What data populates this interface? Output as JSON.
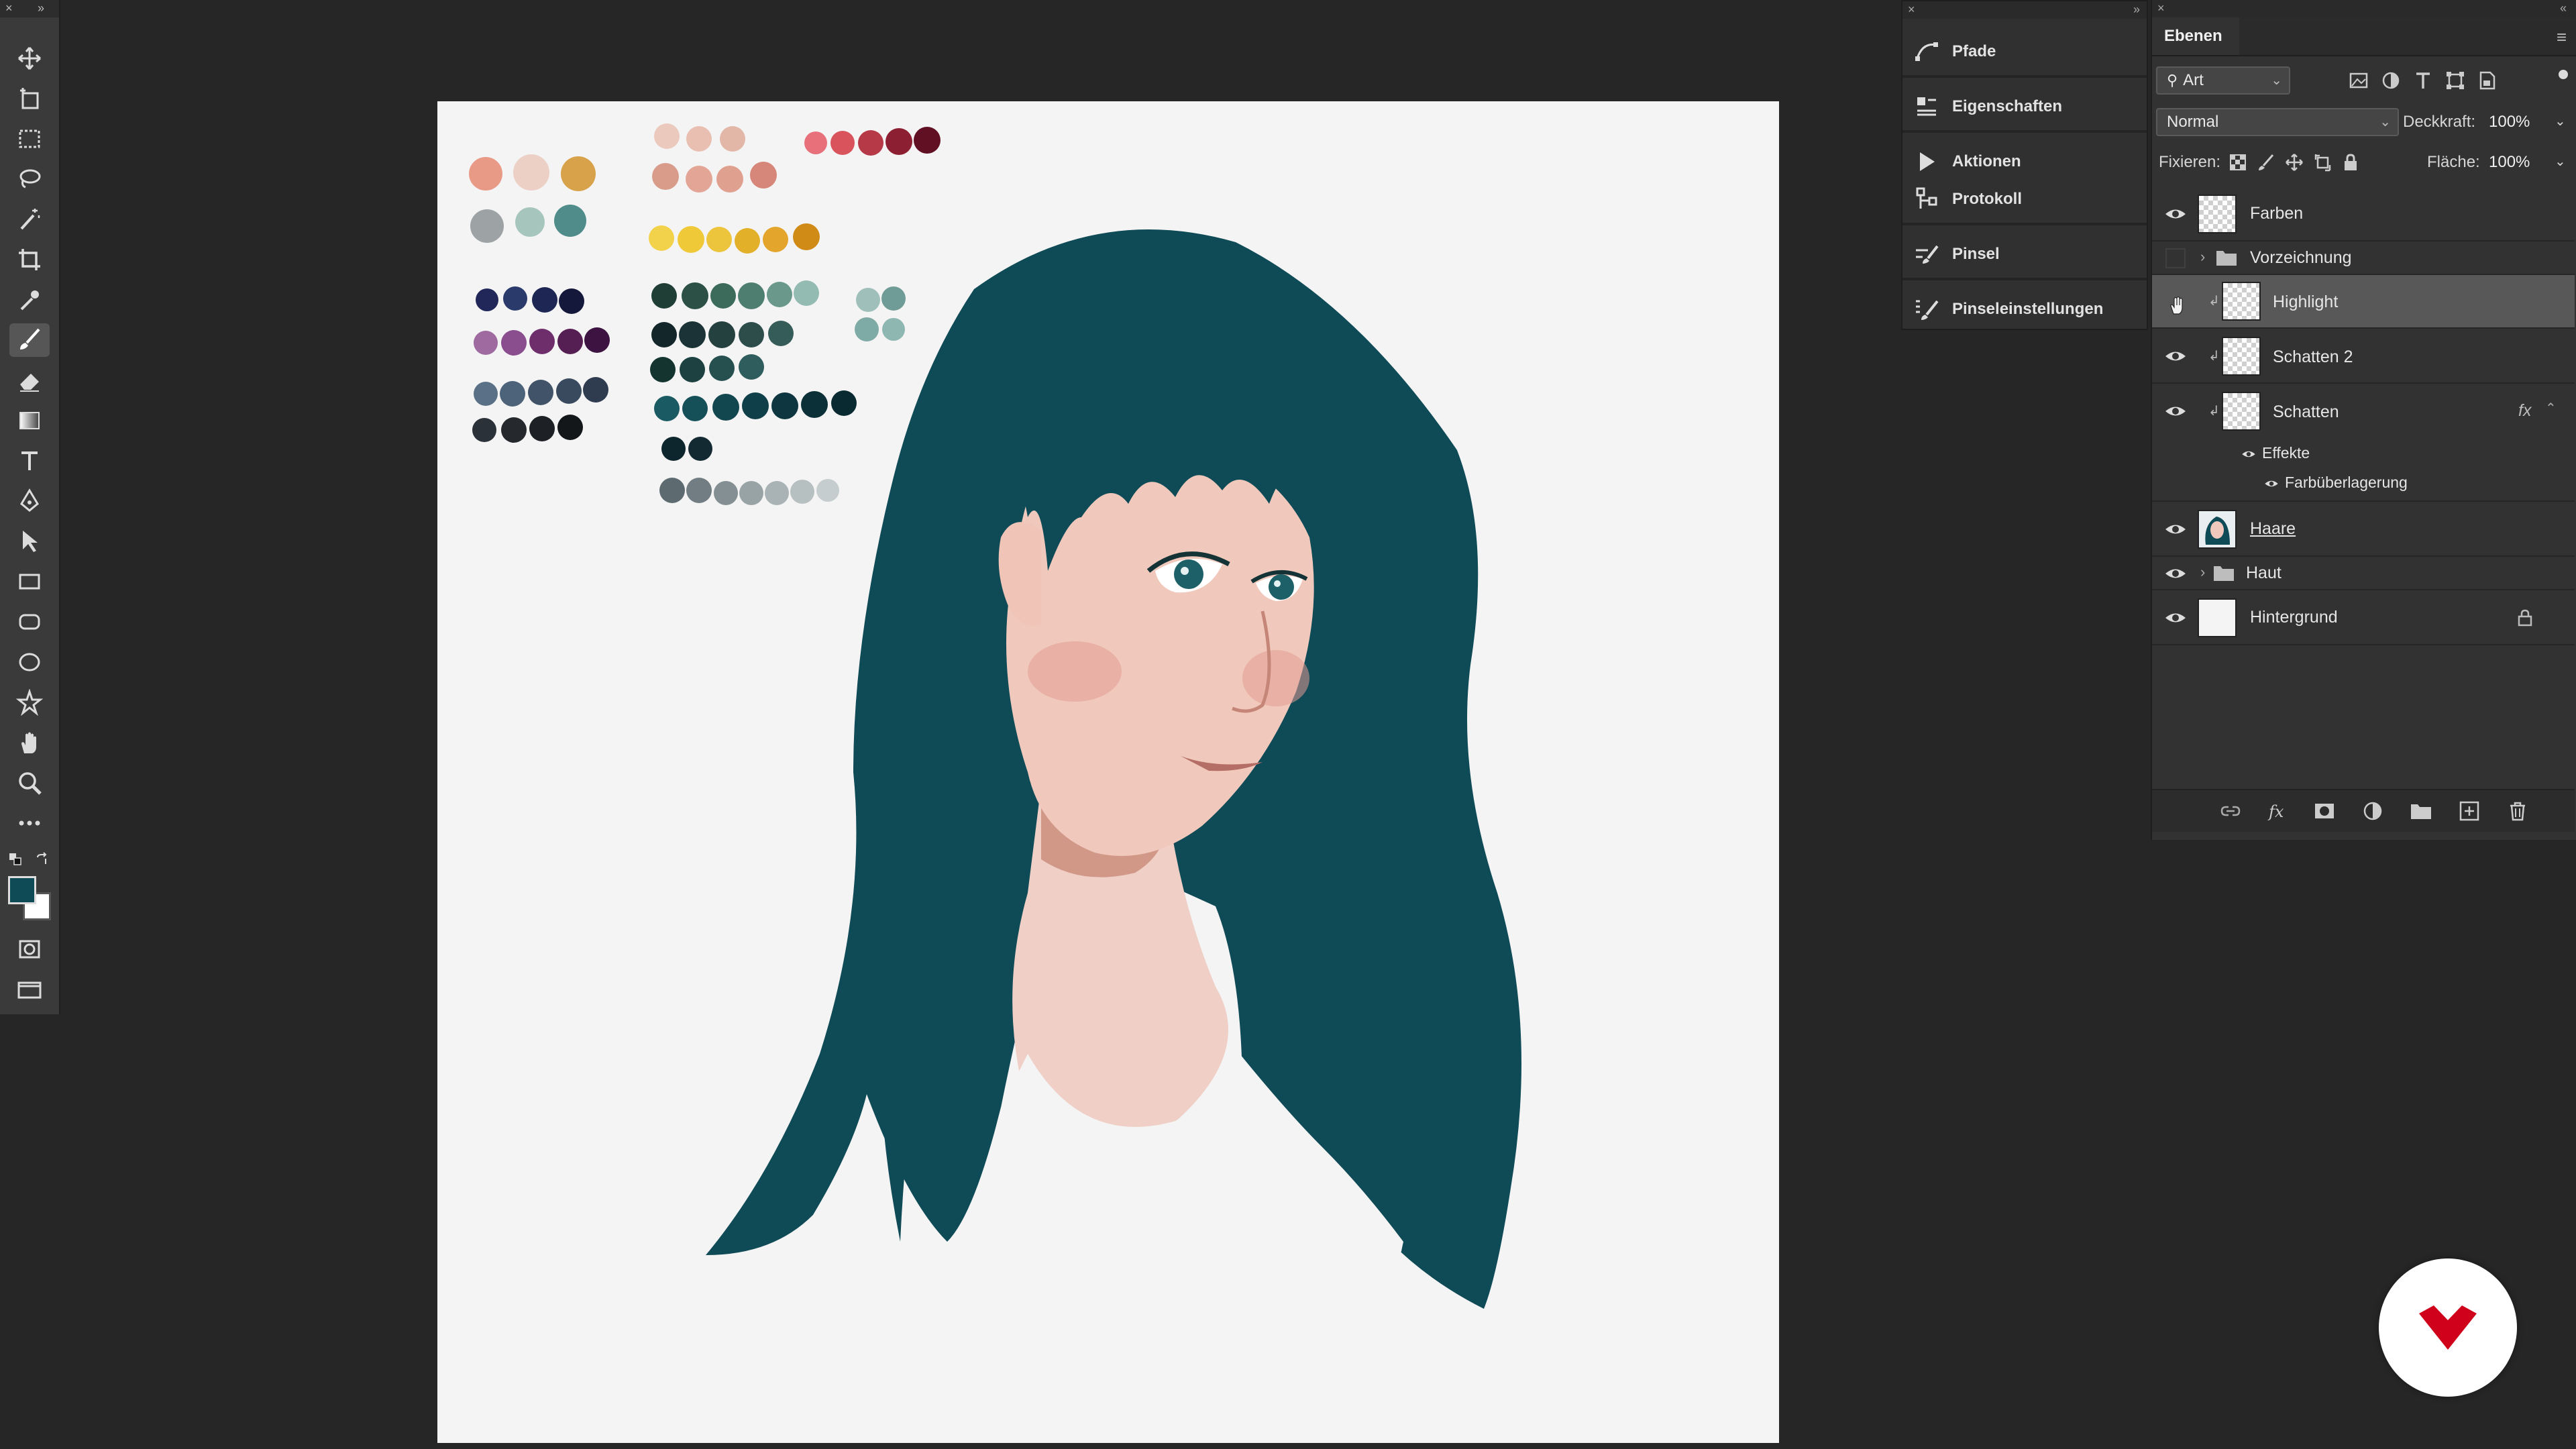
{
  "colors": {
    "foreground": "#0f4a57",
    "background": "#ffffff",
    "hair": "#0f4a57",
    "skin": "#f0c8bc",
    "logo_red": "#d0021b"
  },
  "toolbar": {
    "tools": [
      "move-icon",
      "artboard-icon",
      "marquee-icon",
      "lasso-icon",
      "magic-wand-icon",
      "crop-icon",
      "eyedropper-icon",
      "brush-icon",
      "eraser-icon",
      "gradient-icon",
      "type-icon",
      "pen-icon",
      "path-select-icon",
      "rectangle-icon",
      "rounded-rectangle-icon",
      "ellipse-icon",
      "custom-shape-icon",
      "hand-icon",
      "zoom-icon",
      "more-tools-icon"
    ],
    "active_tool": "brush-icon"
  },
  "dock": {
    "items": [
      {
        "label": "Pfade",
        "icon": "paths-icon"
      },
      {
        "label": "Eigenschaften",
        "icon": "properties-icon"
      },
      {
        "label": "Aktionen",
        "icon": "actions-icon"
      },
      {
        "label": "Protokoll",
        "icon": "history-icon"
      },
      {
        "label": "Pinsel",
        "icon": "brush-panel-icon"
      },
      {
        "label": "Pinseleinstellungen",
        "icon": "brush-settings-icon"
      }
    ]
  },
  "layers_panel": {
    "tab": "Ebenen",
    "filter": "Art",
    "blend_mode": "Normal",
    "opacity_label": "Deckkraft:",
    "opacity": "100%",
    "lock_label": "Fixieren:",
    "fill_label": "Fläche:",
    "fill": "100%",
    "layers": [
      {
        "name": "Farben",
        "visible": true
      },
      {
        "name": "Vorzeichnung",
        "visible": false,
        "type": "group"
      },
      {
        "name": "Highlight",
        "visible": false,
        "selected": true
      },
      {
        "name": "Schatten 2",
        "visible": true
      },
      {
        "name": "Schatten",
        "visible": true,
        "fx": "fx"
      },
      {
        "name": "Effekte",
        "type": "effects-header"
      },
      {
        "name": "Farbüberlagerung",
        "type": "effect"
      },
      {
        "name": "Haare",
        "visible": true
      },
      {
        "name": "Haut",
        "visible": true,
        "type": "group"
      },
      {
        "name": "Hintergrund",
        "visible": true,
        "locked": true
      }
    ]
  }
}
